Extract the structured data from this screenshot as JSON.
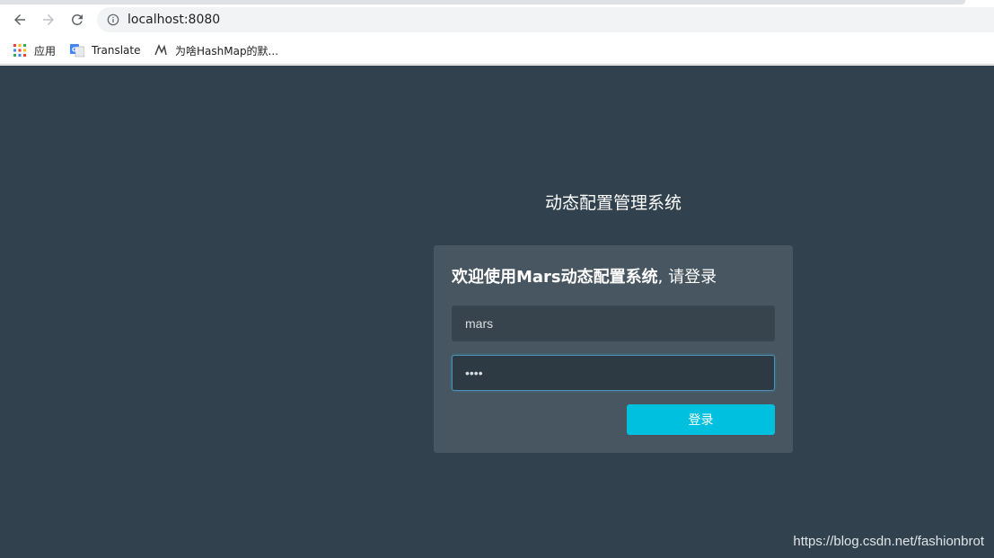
{
  "browser": {
    "url": "localhost:8080",
    "bookmarks": [
      {
        "label": "应用",
        "icon": "apps-grid-icon"
      },
      {
        "label": "Translate",
        "icon": "google-translate-icon"
      },
      {
        "label": "为啥HashMap的默...",
        "icon": "bookmark-site-icon"
      }
    ]
  },
  "page": {
    "system_title": "动态配置管理系统",
    "login": {
      "heading_bold": "欢迎使用Mars动态配置系统",
      "heading_rest": ", 请登录",
      "username_value": "mars",
      "password_value": "••••",
      "submit_label": "登录"
    },
    "watermark": "https://blog.csdn.net/fashionbrot"
  },
  "colors": {
    "page_bg": "#31424e",
    "card_bg": "#475660",
    "button_bg": "#00c0e0"
  }
}
